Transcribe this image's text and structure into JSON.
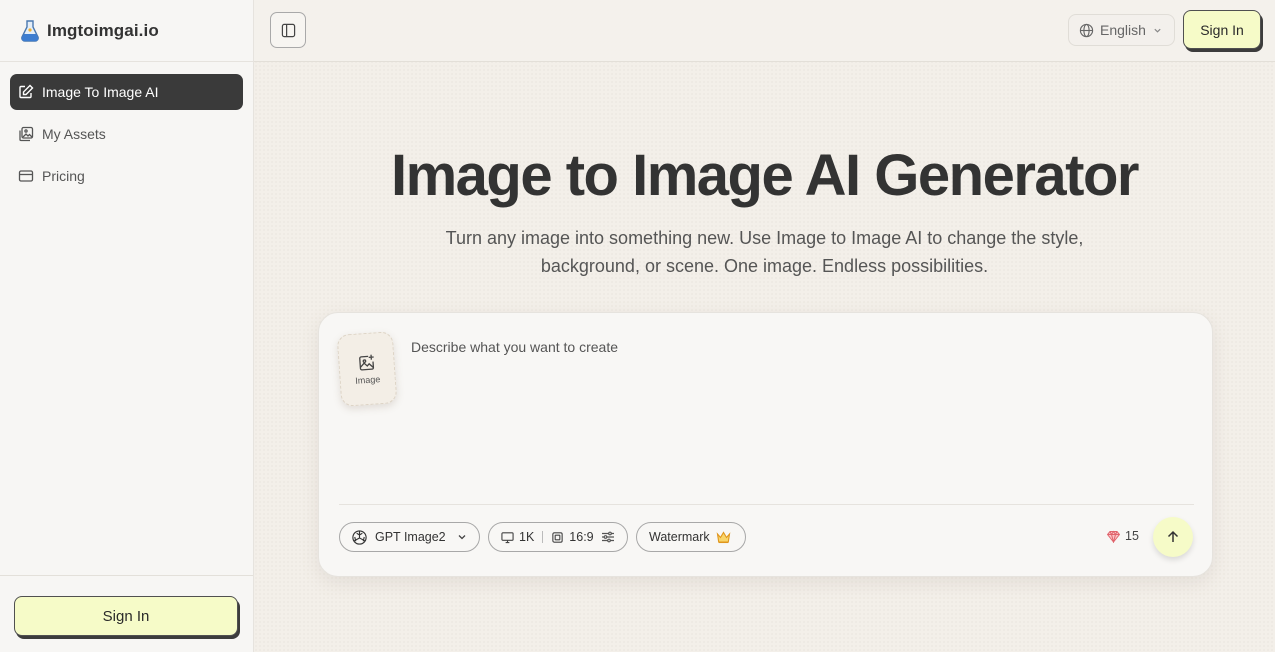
{
  "brand": {
    "name": "Imgtoimgai.io"
  },
  "sidebar": {
    "items": [
      {
        "label": "Image To Image AI",
        "icon": "edit-icon",
        "active": true
      },
      {
        "label": "My Assets",
        "icon": "images-icon",
        "active": false
      },
      {
        "label": "Pricing",
        "icon": "card-icon",
        "active": false
      }
    ],
    "signin_label": "Sign In"
  },
  "header": {
    "language": "English",
    "signin_label": "Sign In"
  },
  "hero": {
    "title": "Image to Image AI Generator",
    "subtitle": "Turn any image into something new. Use Image to Image AI to change the style, background, or scene. One image. Endless possibilities."
  },
  "composer": {
    "upload_label": "Image",
    "prompt_placeholder": "Describe what you want to create",
    "prompt_value": "",
    "model": "GPT Image2",
    "resolution": "1K",
    "aspect_ratio": "16:9",
    "watermark_label": "Watermark",
    "credits": "15"
  },
  "colors": {
    "accent": "#f6fbc8",
    "active_nav": "#3a3a3a",
    "gem": "#e8727a",
    "crown": "#e8a020"
  }
}
